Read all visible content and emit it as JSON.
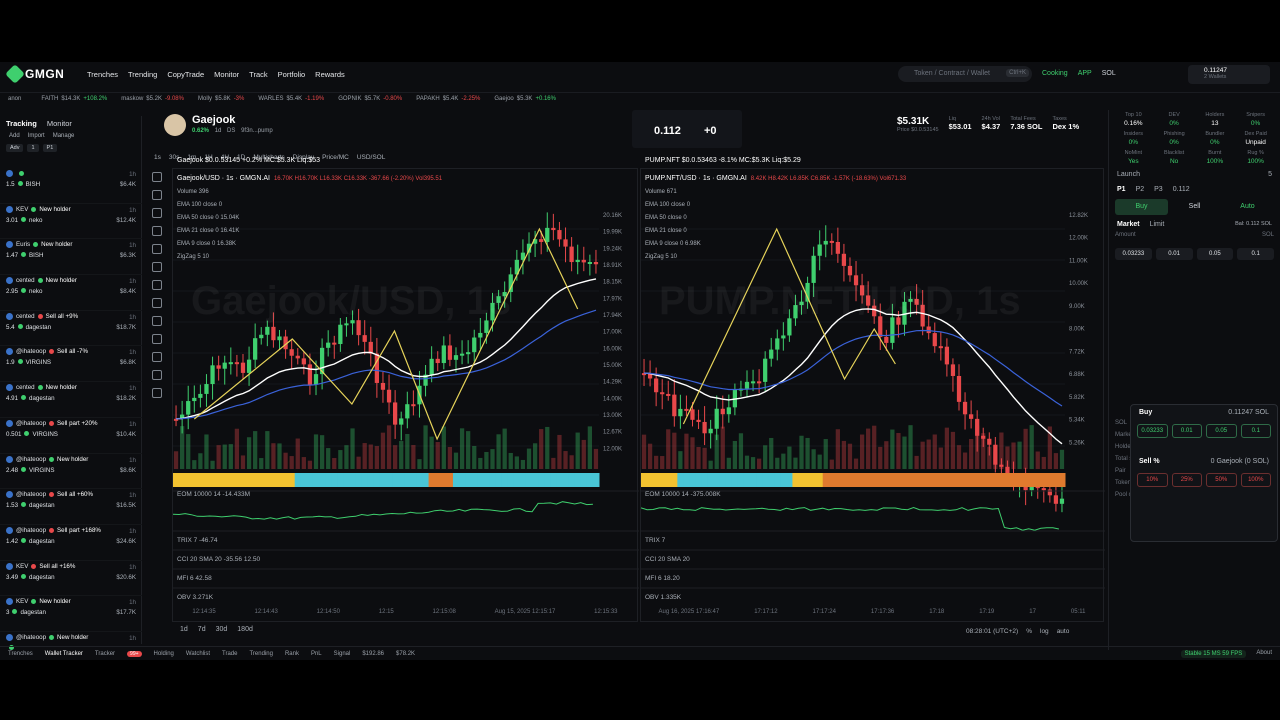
{
  "app": {
    "brand": "GMGN",
    "accent": "#3fcf6e",
    "down": "#e8484a"
  },
  "nav": [
    "Trenches",
    "Trending",
    "CopyTrade",
    "Monitor",
    "Track",
    "Portfolio",
    "Rewards"
  ],
  "search": {
    "placeholder": "Token / Contract / Wallet",
    "kbd": "Ctrl+K"
  },
  "top_right": {
    "cooking": "Cooking",
    "app": "APP",
    "chain": "SOL",
    "wallet_balance": "0.11247",
    "wallet_count": "2 Wallets"
  },
  "ticker": [
    {
      "name": "anon",
      "mc": "",
      "chg": ""
    },
    {
      "name": "FAITH",
      "mc": "$14.3K",
      "chg": "+108.2%"
    },
    {
      "name": "maskow",
      "mc": "$5.2K",
      "chg": "-9.08%"
    },
    {
      "name": "Molly",
      "mc": "$5.8K",
      "chg": "-3%"
    },
    {
      "name": "WARLES",
      "mc": "$5.4K",
      "chg": "-1.19%"
    },
    {
      "name": "GOPNIK",
      "mc": "$5.7K",
      "chg": "-0.80%"
    },
    {
      "name": "PAPAKH",
      "mc": "$5.4K",
      "chg": "-2.25%"
    },
    {
      "name": "Gaejoo",
      "mc": "$5.3K",
      "chg": "+0.16%"
    }
  ],
  "tracking": {
    "tabs": [
      "Tracking",
      "Monitor"
    ],
    "tools": [
      "Add",
      "Import",
      "Manage"
    ],
    "filters": [
      "Adv",
      "1",
      "P1"
    ],
    "feed": [
      {
        "wallet": "",
        "action": "",
        "amount": "1.5",
        "token": "BISH",
        "mc": "$6.4K",
        "ago": "1h"
      },
      {
        "wallet": "KEV",
        "action": "New holder",
        "amount": "3.01",
        "token": "neko",
        "mc": "$12.4K",
        "ago": "1h"
      },
      {
        "wallet": "Euris",
        "action": "New holder",
        "amount": "1.47",
        "token": "BISH",
        "mc": "$6.3K",
        "ago": "1h"
      },
      {
        "wallet": "cented",
        "action": "New holder",
        "amount": "2.95",
        "token": "neko",
        "mc": "$8.4K",
        "ago": "1h"
      },
      {
        "wallet": "cented",
        "action": "Sell all +9%",
        "amount": "5.4",
        "token": "dagestan",
        "mc": "$18.7K",
        "ago": "1h"
      },
      {
        "wallet": "@ihateoop",
        "action": "Sell all -7%",
        "amount": "1.9",
        "token": "VIRGINS",
        "mc": "$6.8K",
        "ago": "1h"
      },
      {
        "wallet": "cented",
        "action": "New holder",
        "amount": "4.91",
        "token": "dagestan",
        "mc": "$18.2K",
        "ago": "1h"
      },
      {
        "wallet": "@ihateoop",
        "action": "Sell part +20%",
        "amount": "0.501",
        "token": "VIRGINS",
        "mc": "$10.4K",
        "ago": "1h"
      },
      {
        "wallet": "@ihateoop",
        "action": "New holder",
        "amount": "2.48",
        "token": "VIRGINS",
        "mc": "$8.6K",
        "ago": "1h"
      },
      {
        "wallet": "@ihateoop",
        "action": "Sell all +60%",
        "amount": "1.53",
        "token": "dagestan",
        "mc": "$16.5K",
        "ago": "1h"
      },
      {
        "wallet": "@ihateoop",
        "action": "Sell part +168%",
        "amount": "1.42",
        "token": "dagestan",
        "mc": "$24.6K",
        "ago": "1h"
      },
      {
        "wallet": "KEV",
        "action": "Sell all +16%",
        "amount": "3.49",
        "token": "dagestan",
        "mc": "$20.6K",
        "ago": "1h"
      },
      {
        "wallet": "KEV",
        "action": "New holder",
        "amount": "3",
        "token": "dagestan",
        "mc": "$17.7K",
        "ago": "1h"
      },
      {
        "wallet": "@ihateoop",
        "action": "New holder",
        "amount": "",
        "token": "",
        "mc": "",
        "ago": "1h"
      }
    ]
  },
  "token": {
    "name": "Gaejook",
    "handle": "Gaejook",
    "chg": "0.62%",
    "age": "1d",
    "source": "DS",
    "extra": "9f3n...pump",
    "boost_value": "0.112",
    "boost_delta": "+0",
    "stats": [
      {
        "label": "Price",
        "value": "$5.31K",
        "sub": "$0.0.53145"
      },
      {
        "label": "Liq",
        "value": "$53.01"
      },
      {
        "label": "24h Vol",
        "value": "$4.37"
      },
      {
        "label": "Total Fees",
        "value": "7.36 SOL"
      },
      {
        "label": "Taxes",
        "value": "Dex 1%"
      }
    ]
  },
  "chart_toolbar": [
    "1s",
    "30s",
    "1m",
    "1H",
    "4H",
    "1D",
    "Multicharts",
    "Display",
    "Price/MC",
    "USD/SOL"
  ],
  "chartA": {
    "title": "Gaejook/USD · 1s · GMGN.AI",
    "ohlc": "16.70K H16.70K L16.33K C16.33K -367.66 (-2.20%) Vol395.51",
    "price_line": "Gaejook $0.0.53145 +0.2% MC:$5.3K Liq:$53",
    "indicators": [
      "Volume 396",
      "EMA 100 close 0",
      "EMA 50 close 0 15.04K",
      "EMA 21 close 0 16.41K",
      "EMA 9 close 0 16.38K",
      "ZigZag 5 10"
    ],
    "watermark": "Gaejook/USD, 1s",
    "eom": "EOM 10000 14 -14.433M",
    "trix": "TRIX 7 -46.74",
    "cci": "CCI 20 SMA 20 -35.56 12.50",
    "mfi": "MFI 6 42.58",
    "obv": "OBV 3.271K",
    "times": [
      "12:14:35",
      "12:14:43",
      "12:14:50",
      "12:15",
      "12:15:08",
      "Aug 15, 2025 12:15:17",
      "12:15:33"
    ],
    "ylabels": [
      "20.16K",
      "19.99K",
      "19.24K",
      "18.91K",
      "18.15K",
      "17.97K",
      "17.94K",
      "17.00K",
      "16.00K",
      "15.00K",
      "14.29K",
      "14.00K",
      "13.00K",
      "12.67K",
      "12.00K"
    ]
  },
  "chartB": {
    "title": "PUMP.NFT/USD · 1s · GMGN.AI",
    "ohlc": "8.42K H8.42K L6.85K C6.85K -1.57K (-18.63%) Vol671.33",
    "price_line": "PUMP.NFT $0.0.53463 -8.1% MC:$5.3K Liq:$5.29",
    "indicators": [
      "Volume 671",
      "EMA 100 close 0",
      "EMA 50 close 0",
      "EMA 21 close 0",
      "EMA 9 close 0 6.98K",
      "ZigZag 5 10"
    ],
    "watermark": "PUMP.NFT/USD, 1s",
    "eom": "EOM 10000 14 -375.008K",
    "trix": "TRIX 7",
    "cci": "CCI 20 SMA 20",
    "mfi": "MFI 6 18.20",
    "obv": "OBV 1.335K",
    "times": [
      "Aug 16, 2025 17:16:47",
      "17:17:12",
      "17:17:24",
      "17:17:36",
      "17:18",
      "17:19",
      "17",
      "05:11"
    ],
    "ylabels": [
      "12.82K",
      "12.00K",
      "11.00K",
      "10.00K",
      "9.00K",
      "8.00K",
      "7.72K",
      "6.88K",
      "5.82K",
      "5.34K",
      "5.26K"
    ]
  },
  "range": [
    "1d",
    "7d",
    "30d",
    "180d"
  ],
  "range_right": [
    "08:28:01 (UTC+2)",
    "%",
    "log",
    "auto"
  ],
  "trade": {
    "stats1": [
      {
        "l": "Top 10",
        "v": "0.16%"
      },
      {
        "l": "DEV",
        "v": "0%"
      },
      {
        "l": "Holders",
        "v": "13"
      },
      {
        "l": "Snipers",
        "v": "0%"
      }
    ],
    "stats2": [
      {
        "l": "Insiders",
        "v": "0%"
      },
      {
        "l": "Phishing",
        "v": "0%"
      },
      {
        "l": "Bundler",
        "v": "0%"
      },
      {
        "l": "Dex Paid",
        "v": "Unpaid"
      }
    ],
    "stats3": [
      {
        "l": "NoMint",
        "v": "Yes"
      },
      {
        "l": "Blacklist",
        "v": "No"
      },
      {
        "l": "Burnt",
        "v": "100%"
      },
      {
        "l": "Rug %",
        "v": "100%"
      }
    ],
    "launch": "Launch",
    "launch_n": "5",
    "presets": [
      "P1",
      "P2",
      "P3"
    ],
    "preset_amt": "0.112",
    "buy": "Buy",
    "sell": "Sell",
    "auto": "Auto",
    "market": "Market",
    "limit": "Limit",
    "bal": "Bal: 0.112 SOL",
    "amount_label": "Amount",
    "amount_unit": "SOL",
    "amounts": [
      "0.03233",
      "0.01",
      "0.05",
      "0.1"
    ],
    "popup_buy": [
      "0.03233",
      "0.01",
      "0.05",
      "0.1"
    ],
    "popup_sell": [
      "10%",
      "25%",
      "50%",
      "100%"
    ],
    "popup_buy_label": "Buy",
    "popup_sell_label": "Sell %",
    "popup_bal": "0.11247 SOL",
    "popup_tok": "0 Gaejook (0 SOL)",
    "info": [
      {
        "l": "SOL",
        "v": "0.141/0.015 (+831.8%)  $27.16"
      },
      {
        "l": "Market cap",
        "v": "$5.31K"
      },
      {
        "l": "Holders",
        "v": "13"
      },
      {
        "l": "Total supply",
        "v": "999.3M"
      },
      {
        "l": "Pair",
        "v": "4mbP...feuE"
      },
      {
        "l": "Token creator",
        "v": "H37L...fCcu (66.43 SOL)"
      },
      {
        "l": "Pool created",
        "v": "08/15/2025 12:14:14"
      }
    ]
  },
  "bottom": {
    "items": [
      "Trenches",
      "Wallet Tracker",
      "Tracker",
      "Holding",
      "Watchlist",
      "Trade",
      "Trending",
      "Rank",
      "PnL",
      "Signal"
    ],
    "badge": "99+",
    "price1": "$192.86",
    "price2": "$78.2K",
    "stable": "Stable 15 MS",
    "fps": "59 FPS",
    "about": "About"
  }
}
